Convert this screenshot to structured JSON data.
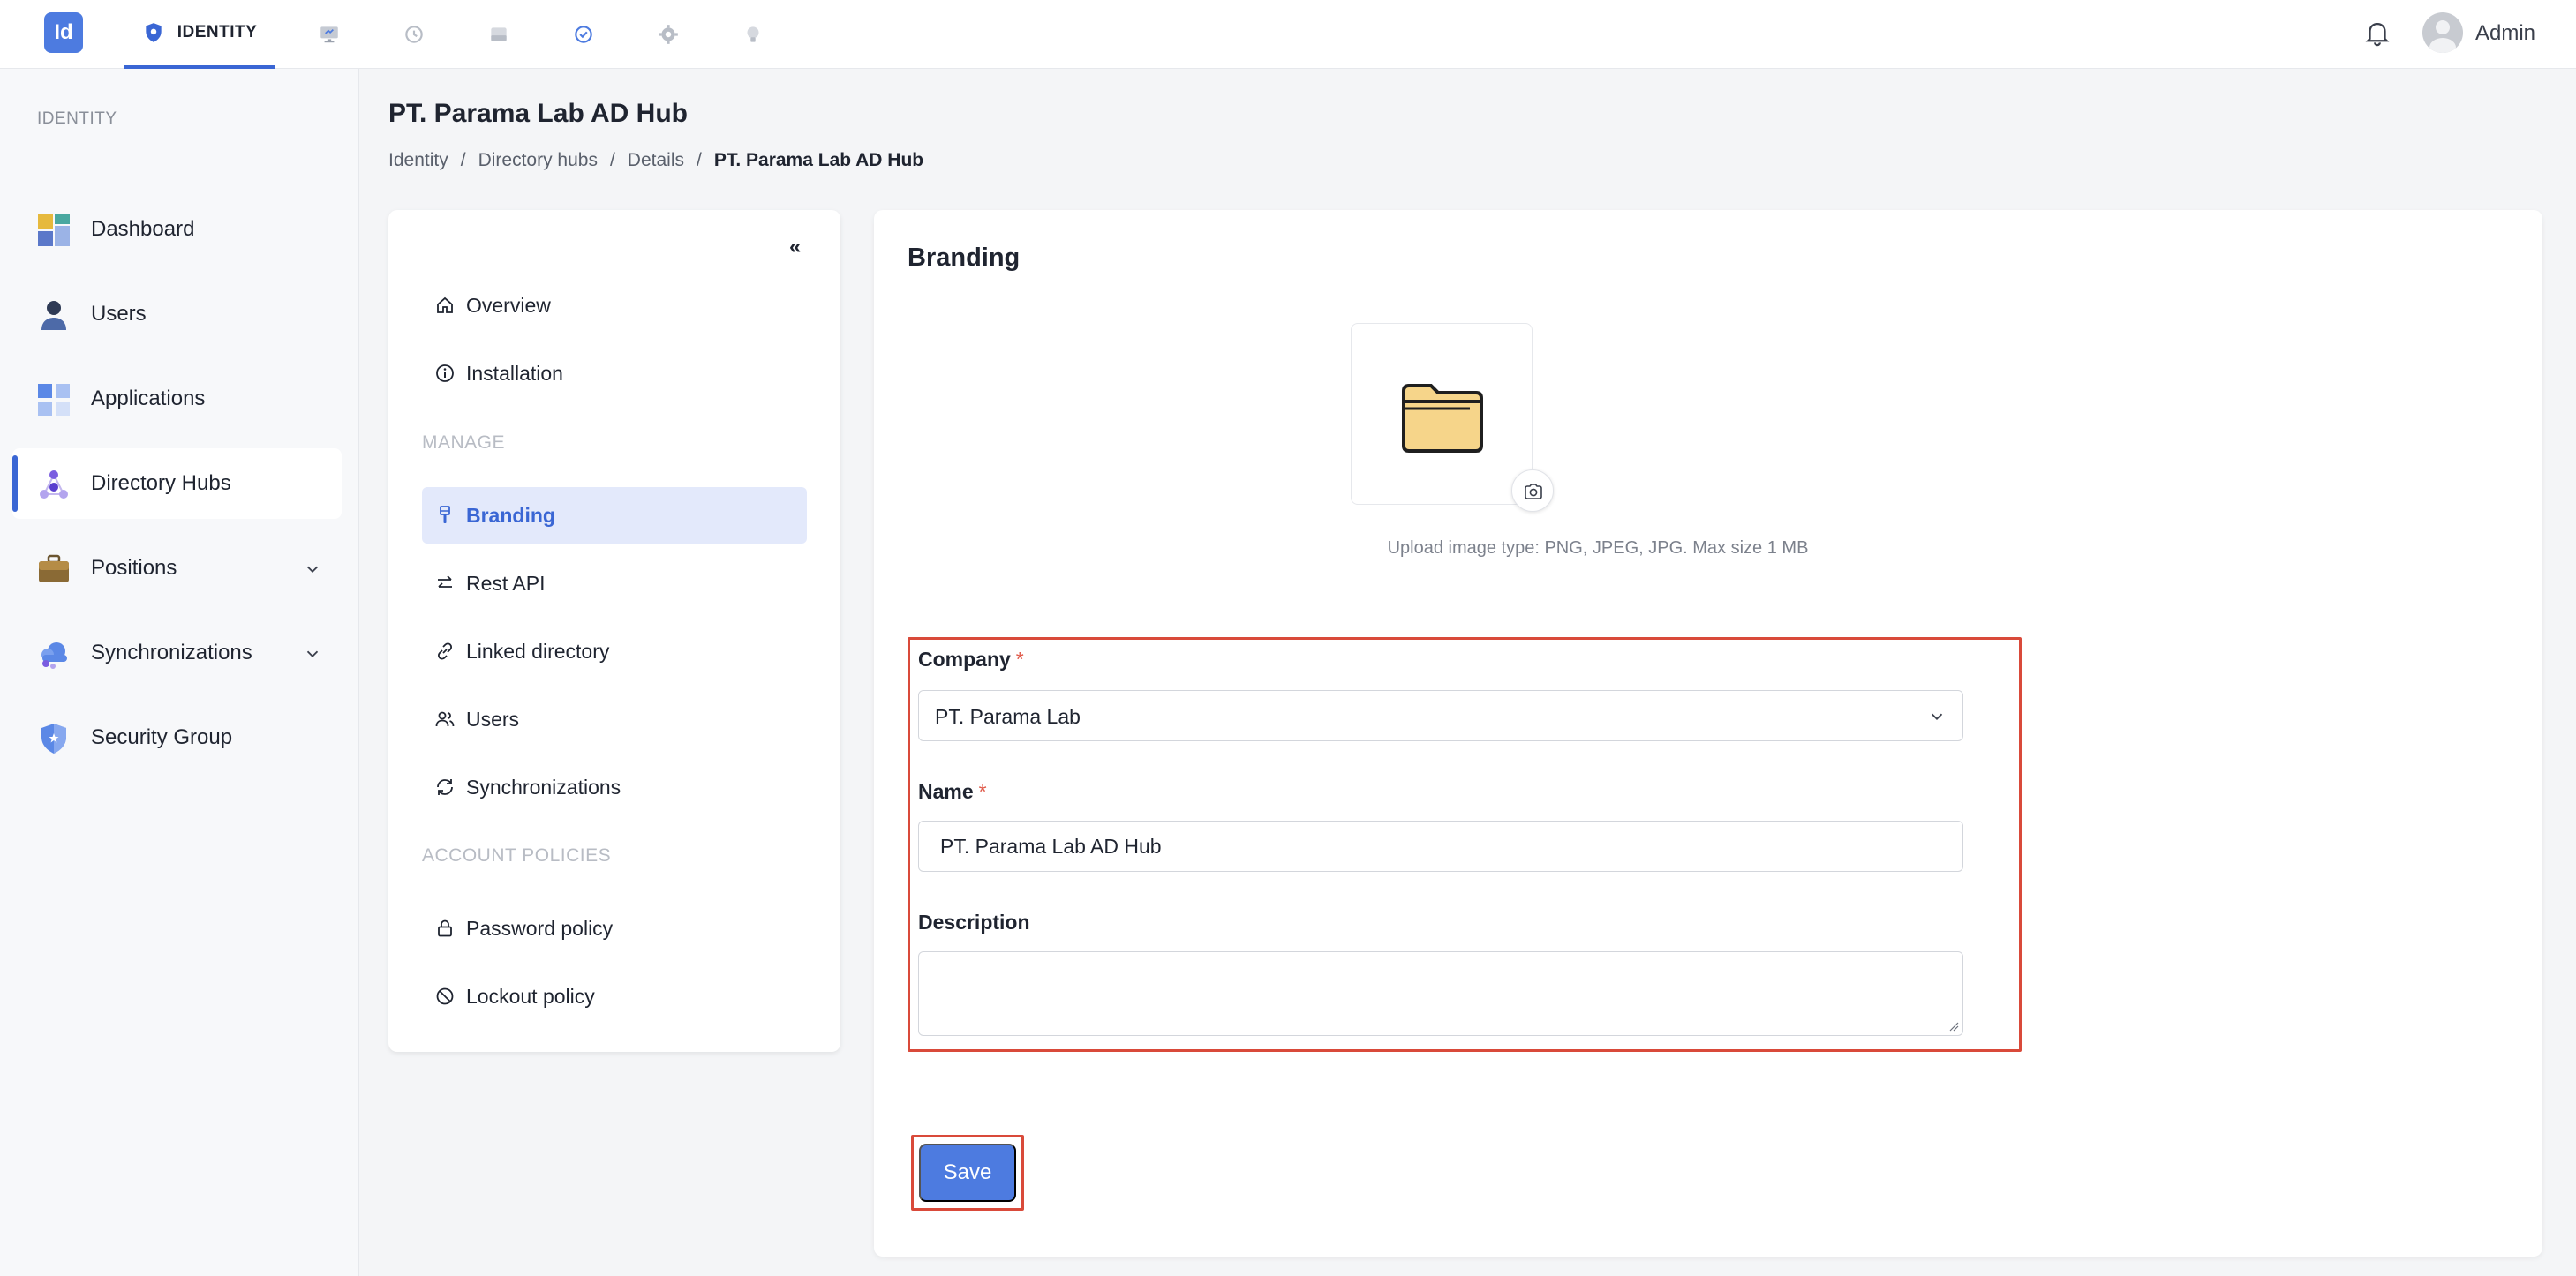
{
  "app": {
    "logo_text": "Id",
    "active_module": "IDENTITY"
  },
  "header": {
    "top_icons": [
      "shield-icon",
      "monitor-icon",
      "history-icon",
      "drive-icon",
      "check-circle-icon",
      "gear-icon",
      "bulb-icon"
    ],
    "user_name": "Admin"
  },
  "sidebar": {
    "section_label": "IDENTITY",
    "items": [
      {
        "label": "Dashboard",
        "icon": "dashboard-icon"
      },
      {
        "label": "Users",
        "icon": "user-icon"
      },
      {
        "label": "Applications",
        "icon": "applications-icon"
      },
      {
        "label": "Directory Hubs",
        "icon": "directory-hubs-icon",
        "active": true
      },
      {
        "label": "Positions",
        "icon": "briefcase-icon",
        "expandable": true
      },
      {
        "label": "Synchronizations",
        "icon": "cloud-sync-icon",
        "expandable": true
      },
      {
        "label": "Security Group",
        "icon": "security-shield-icon"
      }
    ]
  },
  "page": {
    "title": "PT. Parama Lab AD Hub",
    "breadcrumb": [
      "Identity",
      "Directory hubs",
      "Details",
      "PT. Parama Lab AD Hub"
    ]
  },
  "subnav": {
    "collapse_label": "«",
    "items_top": [
      {
        "label": "Overview",
        "icon": "home-icon"
      },
      {
        "label": "Installation",
        "icon": "info-icon"
      }
    ],
    "section_manage": "MANAGE",
    "items_manage": [
      {
        "label": "Branding",
        "icon": "brush-icon",
        "active": true
      },
      {
        "label": "Rest API",
        "icon": "swap-icon"
      },
      {
        "label": "Linked directory",
        "icon": "link-icon"
      },
      {
        "label": "Users",
        "icon": "users-icon"
      },
      {
        "label": "Synchronizations",
        "icon": "refresh-icon"
      }
    ],
    "section_policies": "ACCOUNT POLICIES",
    "items_policies": [
      {
        "label": "Password policy",
        "icon": "lock-icon"
      },
      {
        "label": "Lockout policy",
        "icon": "ban-icon"
      }
    ]
  },
  "branding": {
    "title": "Branding",
    "upload_hint": "Upload image type: PNG, JPEG, JPG. Max size 1 MB",
    "form": {
      "company_label": "Company",
      "company_value": "PT. Parama Lab",
      "name_label": "Name",
      "name_value": "PT. Parama Lab AD Hub",
      "description_label": "Description",
      "description_value": "",
      "required_mark": "*"
    },
    "save_label": "Save"
  },
  "colors": {
    "accent": "#4d7be0",
    "active_nav_bg": "#e3e9fb",
    "highlight_outline": "#d94a3a"
  }
}
